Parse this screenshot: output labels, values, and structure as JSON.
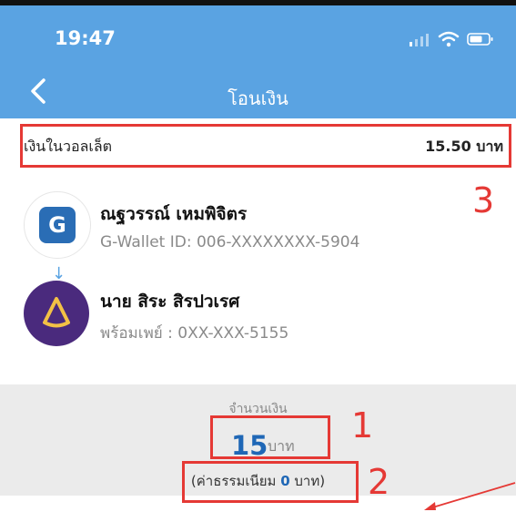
{
  "status_bar": {
    "time": "19:47"
  },
  "nav": {
    "title": "โอนเงิน"
  },
  "wallet": {
    "label": "เงินในวอลเล็ต",
    "amount": "15.50 บาท"
  },
  "sender": {
    "name": "ณฐวรรณ์ เหมพิจิตร",
    "id": "G-Wallet ID: 006-XXXXXXXX-5904",
    "avatar_letter": "G"
  },
  "receiver": {
    "name": "นาย สิระ สิรปวเรศ",
    "id": "พร้อมเพย์ : 0XX-XXX-5155"
  },
  "amount": {
    "caption": "จำนวนเงิน",
    "value": "15",
    "unit": "บาท"
  },
  "fee": {
    "prefix": "(ค่าธรรมเนียม ",
    "value": "0",
    "suffix": " บาท)"
  },
  "annotations": {
    "a1": "1",
    "a2": "2",
    "a3": "3"
  },
  "colors": {
    "header": "#5aa3e2",
    "accent_blue": "#1f67b6",
    "annotation_red": "#e53935",
    "panel_gray": "#ebebeb"
  },
  "icons": {
    "back": "chevron-left-icon",
    "signal": "signal-icon",
    "wifi": "wifi-icon",
    "battery": "battery-icon",
    "transfer": "arrow-down-icon"
  }
}
